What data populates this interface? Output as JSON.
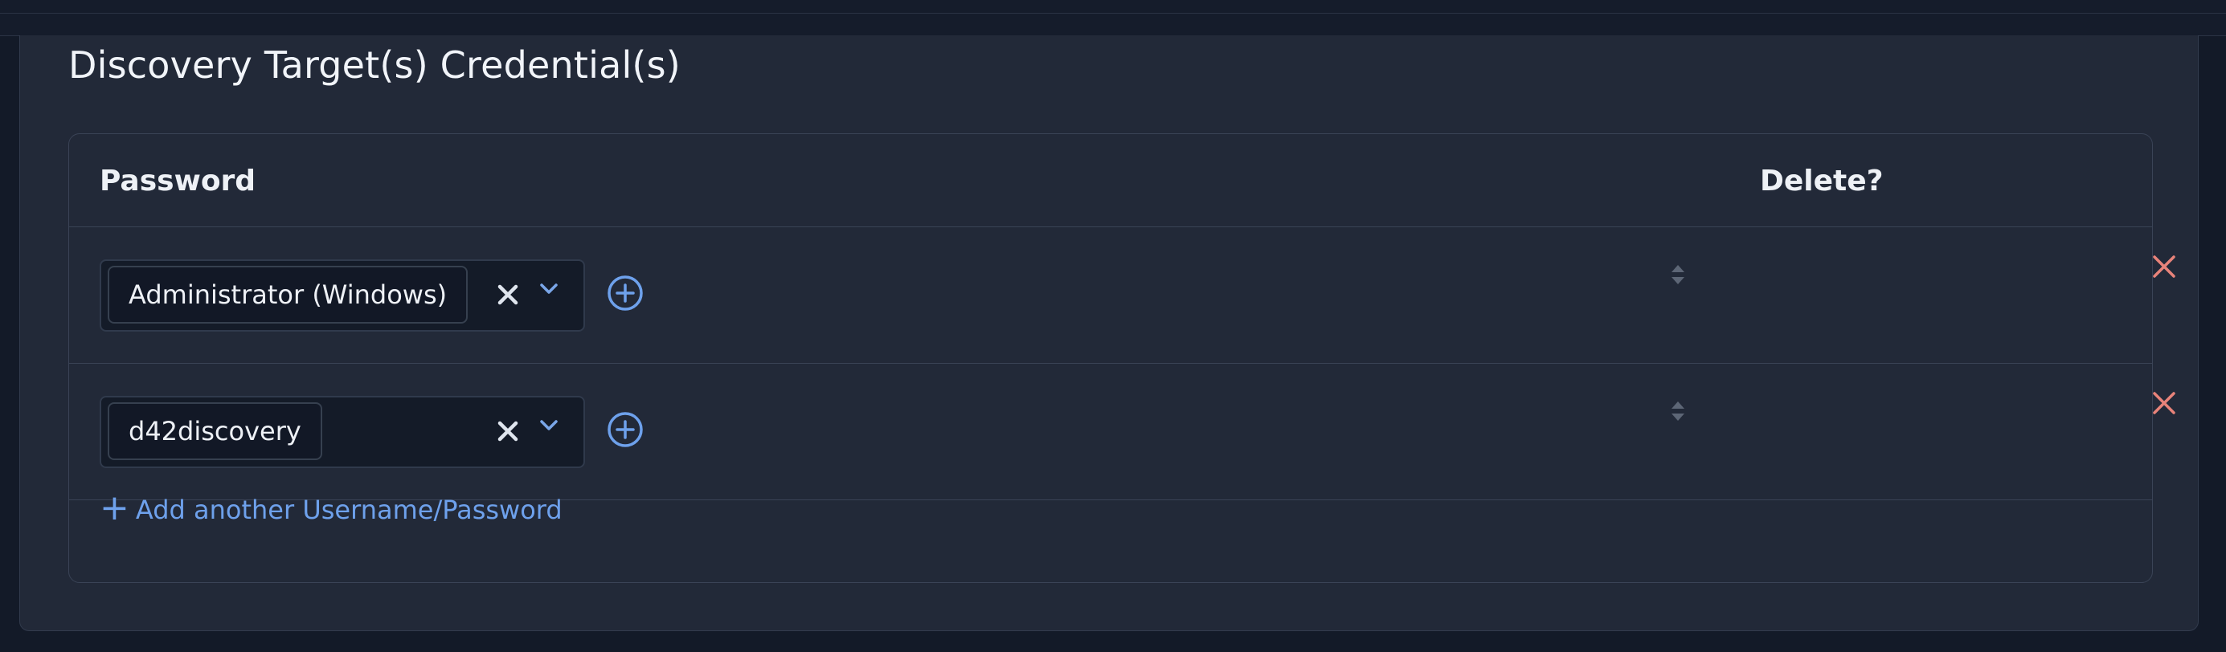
{
  "section": {
    "title": "Discovery Target(s) Credential(s)"
  },
  "table": {
    "headers": {
      "password": "Password",
      "delete": "Delete?"
    },
    "rows": [
      {
        "credential": "Administrator (Windows)"
      },
      {
        "credential": "d42discovery"
      }
    ],
    "add_link_label": "Add another Username/Password",
    "add_link_plus": "+"
  },
  "icons": {
    "clear": "x-icon",
    "dropdown": "chevron-down-icon",
    "add": "plus-circle-icon",
    "sort": "sort-icon",
    "delete": "close-icon"
  },
  "colors": {
    "accent": "#6ea1ec",
    "delete": "#e8837a",
    "panel": "#222938",
    "background": "#131a28"
  }
}
